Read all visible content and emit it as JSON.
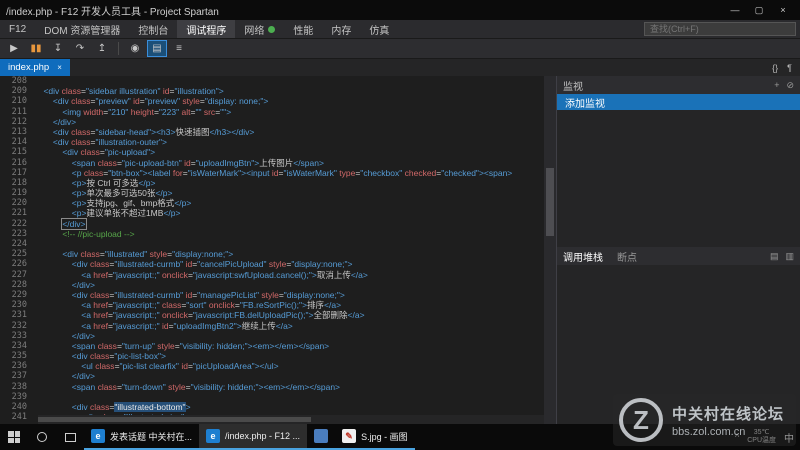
{
  "window": {
    "title": "/index.php - F12 开发人员工具 - Project Spartan",
    "controls": [
      {
        "id": "minimize",
        "glyph": "—"
      },
      {
        "id": "maximize",
        "glyph": "▢"
      },
      {
        "id": "close",
        "glyph": "×"
      }
    ]
  },
  "menubar": {
    "items": [
      {
        "id": "f12",
        "label": "F12"
      },
      {
        "id": "dom-explorer",
        "label": "DOM 资源管理器"
      },
      {
        "id": "console",
        "label": "控制台"
      },
      {
        "id": "debugger",
        "label": "调试程序",
        "active": true
      },
      {
        "id": "network",
        "label": "网络",
        "badge": true
      },
      {
        "id": "performance",
        "label": "性能"
      },
      {
        "id": "memory",
        "label": "内存"
      },
      {
        "id": "emulation",
        "label": "仿真"
      }
    ],
    "search_placeholder": "查找(Ctrl+F)"
  },
  "toolbar": {
    "icons": [
      {
        "id": "continue",
        "glyph": "▶"
      },
      {
        "id": "break",
        "glyph": "▮▮",
        "color": "#e8973d"
      },
      {
        "id": "step-into",
        "glyph": "↧"
      },
      {
        "id": "step-over",
        "glyph": "↷"
      },
      {
        "id": "step-out",
        "glyph": "↥"
      },
      {
        "id": "divider"
      },
      {
        "id": "break-on-exception",
        "glyph": "◉"
      },
      {
        "id": "just-my-code",
        "glyph": "▤",
        "highlight": true
      },
      {
        "id": "debug-options",
        "glyph": "≡"
      }
    ]
  },
  "tabstrip": {
    "tabs": [
      {
        "id": "index-php",
        "label": "index.php",
        "close": "×",
        "active": true
      }
    ],
    "right_icons": [
      {
        "id": "pretty-print",
        "glyph": "{}"
      },
      {
        "id": "word-wrap",
        "glyph": "¶"
      }
    ]
  },
  "editor": {
    "lines": [
      {
        "n": 208,
        "t": []
      },
      {
        "n": 209,
        "t": [
          [
            "g",
            "    "
          ],
          [
            "b",
            "<div "
          ],
          [
            "r",
            "class"
          ],
          [
            "g",
            "="
          ],
          [
            "b",
            "\"sidebar illustration\" "
          ],
          [
            "r",
            "id"
          ],
          [
            "g",
            "="
          ],
          [
            "b",
            "\"illustration\">"
          ]
        ]
      },
      {
        "n": 210,
        "t": [
          [
            "g",
            "        "
          ],
          [
            "b",
            "<div "
          ],
          [
            "r",
            "class"
          ],
          [
            "g",
            "="
          ],
          [
            "b",
            "\"preview\" "
          ],
          [
            "r",
            "id"
          ],
          [
            "g",
            "="
          ],
          [
            "b",
            "\"preview\" "
          ],
          [
            "r",
            "style"
          ],
          [
            "g",
            "="
          ],
          [
            "b",
            "\"display: none;\">"
          ]
        ]
      },
      {
        "n": 211,
        "t": [
          [
            "g",
            "            "
          ],
          [
            "b",
            "<img "
          ],
          [
            "r",
            "width"
          ],
          [
            "g",
            "="
          ],
          [
            "b",
            "\"210\" "
          ],
          [
            "r",
            "height"
          ],
          [
            "g",
            "="
          ],
          [
            "b",
            "\"223\" "
          ],
          [
            "r",
            "alt"
          ],
          [
            "g",
            "="
          ],
          [
            "b",
            "\"\" "
          ],
          [
            "r",
            "src"
          ],
          [
            "g",
            "="
          ],
          [
            "b",
            "\"\">"
          ]
        ]
      },
      {
        "n": 212,
        "t": [
          [
            "g",
            "        "
          ],
          [
            "b",
            "</div>"
          ]
        ]
      },
      {
        "n": 213,
        "t": [
          [
            "g",
            "        "
          ],
          [
            "b",
            "<div "
          ],
          [
            "r",
            "class"
          ],
          [
            "g",
            "="
          ],
          [
            "b",
            "\"sidebar-head\"><h3>"
          ],
          [
            "g",
            "快速插图"
          ],
          [
            "b",
            "</h3></div>"
          ]
        ]
      },
      {
        "n": 214,
        "t": [
          [
            "g",
            "        "
          ],
          [
            "b",
            "<div "
          ],
          [
            "r",
            "class"
          ],
          [
            "g",
            "="
          ],
          [
            "b",
            "\"illustration-outer\">"
          ]
        ]
      },
      {
        "n": 215,
        "t": [
          [
            "g",
            "            "
          ],
          [
            "b",
            "<div "
          ],
          [
            "r",
            "class"
          ],
          [
            "g",
            "="
          ],
          [
            "b",
            "\"pic-upload\">"
          ]
        ]
      },
      {
        "n": 216,
        "t": [
          [
            "g",
            "                "
          ],
          [
            "b",
            "<span "
          ],
          [
            "r",
            "class"
          ],
          [
            "g",
            "="
          ],
          [
            "b",
            "\"pic-upload-btn\" "
          ],
          [
            "r",
            "id"
          ],
          [
            "g",
            "="
          ],
          [
            "b",
            "\"uploadImgBtn\">"
          ],
          [
            "g",
            "上传图片"
          ],
          [
            "b",
            "</span>"
          ]
        ]
      },
      {
        "n": 217,
        "t": [
          [
            "g",
            "                "
          ],
          [
            "b",
            "<p "
          ],
          [
            "r",
            "class"
          ],
          [
            "g",
            "="
          ],
          [
            "b",
            "\"btn-box\"><label "
          ],
          [
            "r",
            "for"
          ],
          [
            "g",
            "="
          ],
          [
            "b",
            "\"isWaterMark\"><input "
          ],
          [
            "r",
            "id"
          ],
          [
            "g",
            "="
          ],
          [
            "b",
            "\"isWaterMark\" "
          ],
          [
            "r",
            "type"
          ],
          [
            "g",
            "="
          ],
          [
            "b",
            "\"checkbox\" "
          ],
          [
            "r",
            "checked"
          ],
          [
            "g",
            "="
          ],
          [
            "b",
            "\"checked\"><span>"
          ]
        ]
      },
      {
        "n": 218,
        "t": [
          [
            "g",
            "                "
          ],
          [
            "b",
            "<p>"
          ],
          [
            "g",
            "按 Ctrl 可多选"
          ],
          [
            "b",
            "</p>"
          ]
        ]
      },
      {
        "n": 219,
        "t": [
          [
            "g",
            "                "
          ],
          [
            "b",
            "<p>"
          ],
          [
            "g",
            "单次最多可选50张"
          ],
          [
            "b",
            "</p>"
          ]
        ]
      },
      {
        "n": 220,
        "t": [
          [
            "g",
            "                "
          ],
          [
            "b",
            "<p>"
          ],
          [
            "g",
            "支持jpg、gif、bmp格式"
          ],
          [
            "b",
            "</p>"
          ]
        ]
      },
      {
        "n": 221,
        "t": [
          [
            "g",
            "                "
          ],
          [
            "b",
            "<p>"
          ],
          [
            "g",
            "建议单张不超过1MB"
          ],
          [
            "b",
            "</p>"
          ]
        ]
      },
      {
        "n": 222,
        "t": [
          [
            "g",
            "            "
          ],
          [
            "x",
            "</div>"
          ]
        ]
      },
      {
        "n": 223,
        "t": [
          [
            "g",
            "            "
          ],
          [
            "c",
            "<!-- //pic-upload -->"
          ]
        ]
      },
      {
        "n": 224,
        "t": []
      },
      {
        "n": 225,
        "t": [
          [
            "g",
            "            "
          ],
          [
            "b",
            "<div "
          ],
          [
            "r",
            "class"
          ],
          [
            "g",
            "="
          ],
          [
            "b",
            "\"illustrated\" "
          ],
          [
            "r",
            "style"
          ],
          [
            "g",
            "="
          ],
          [
            "b",
            "\"display:none;\">"
          ]
        ]
      },
      {
        "n": 226,
        "t": [
          [
            "g",
            "                "
          ],
          [
            "b",
            "<div "
          ],
          [
            "r",
            "class"
          ],
          [
            "g",
            "="
          ],
          [
            "b",
            "\"illustrated-curmb\" "
          ],
          [
            "r",
            "id"
          ],
          [
            "g",
            "="
          ],
          [
            "b",
            "\"cancelPicUpload\" "
          ],
          [
            "r",
            "style"
          ],
          [
            "g",
            "="
          ],
          [
            "b",
            "\"display:none;\">"
          ]
        ]
      },
      {
        "n": 227,
        "t": [
          [
            "g",
            "                    "
          ],
          [
            "b",
            "<a "
          ],
          [
            "r",
            "href"
          ],
          [
            "g",
            "="
          ],
          [
            "b",
            "\"javascript:;\" "
          ],
          [
            "r",
            "onclick"
          ],
          [
            "g",
            "="
          ],
          [
            "b",
            "\"javascript:swfUpload.cancel();\">"
          ],
          [
            "g",
            "取消上传"
          ],
          [
            "b",
            "</a>"
          ]
        ]
      },
      {
        "n": 228,
        "t": [
          [
            "g",
            "                "
          ],
          [
            "b",
            "</div>"
          ]
        ]
      },
      {
        "n": 229,
        "t": [
          [
            "g",
            "                "
          ],
          [
            "b",
            "<div "
          ],
          [
            "r",
            "class"
          ],
          [
            "g",
            "="
          ],
          [
            "b",
            "\"illustrated-curmb\" "
          ],
          [
            "r",
            "id"
          ],
          [
            "g",
            "="
          ],
          [
            "b",
            "\"managePicList\" "
          ],
          [
            "r",
            "style"
          ],
          [
            "g",
            "="
          ],
          [
            "b",
            "\"display:none;\">"
          ]
        ]
      },
      {
        "n": 230,
        "t": [
          [
            "g",
            "                    "
          ],
          [
            "b",
            "<a "
          ],
          [
            "r",
            "href"
          ],
          [
            "g",
            "="
          ],
          [
            "b",
            "\"javascript:;\" "
          ],
          [
            "r",
            "class"
          ],
          [
            "g",
            "="
          ],
          [
            "b",
            "\"sort\" "
          ],
          [
            "r",
            "onclick"
          ],
          [
            "g",
            "="
          ],
          [
            "b",
            "\"FB.reSortPic();\">"
          ],
          [
            "g",
            "排序"
          ],
          [
            "b",
            "</a>"
          ]
        ]
      },
      {
        "n": 231,
        "t": [
          [
            "g",
            "                    "
          ],
          [
            "b",
            "<a "
          ],
          [
            "r",
            "href"
          ],
          [
            "g",
            "="
          ],
          [
            "b",
            "\"javascript:;\" "
          ],
          [
            "r",
            "onclick"
          ],
          [
            "g",
            "="
          ],
          [
            "b",
            "\"javascript:FB.delUploadPic();\">"
          ],
          [
            "g",
            "全部删除"
          ],
          [
            "b",
            "</a>"
          ]
        ]
      },
      {
        "n": 232,
        "t": [
          [
            "g",
            "                    "
          ],
          [
            "b",
            "<a "
          ],
          [
            "r",
            "href"
          ],
          [
            "g",
            "="
          ],
          [
            "b",
            "\"javascript:;\" "
          ],
          [
            "r",
            "id"
          ],
          [
            "g",
            "="
          ],
          [
            "b",
            "\"uploadImgBtn2\">"
          ],
          [
            "g",
            "继续上传"
          ],
          [
            "b",
            "</a>"
          ]
        ]
      },
      {
        "n": 233,
        "t": [
          [
            "g",
            "                "
          ],
          [
            "b",
            "</div>"
          ]
        ]
      },
      {
        "n": 234,
        "t": [
          [
            "g",
            "                "
          ],
          [
            "b",
            "<span "
          ],
          [
            "r",
            "class"
          ],
          [
            "g",
            "="
          ],
          [
            "b",
            "\"turn-up\" "
          ],
          [
            "r",
            "style"
          ],
          [
            "g",
            "="
          ],
          [
            "b",
            "\"visibility: hidden;\"><em></em></span>"
          ]
        ]
      },
      {
        "n": 235,
        "t": [
          [
            "g",
            "                "
          ],
          [
            "b",
            "<div "
          ],
          [
            "r",
            "class"
          ],
          [
            "g",
            "="
          ],
          [
            "b",
            "\"pic-list-box\">"
          ]
        ]
      },
      {
        "n": 236,
        "t": [
          [
            "g",
            "                    "
          ],
          [
            "b",
            "<ul "
          ],
          [
            "r",
            "class"
          ],
          [
            "g",
            "="
          ],
          [
            "b",
            "\"pic-list clearfix\" "
          ],
          [
            "r",
            "id"
          ],
          [
            "g",
            "="
          ],
          [
            "b",
            "\"picUploadArea\"></ul>"
          ]
        ]
      },
      {
        "n": 237,
        "t": [
          [
            "g",
            "                "
          ],
          [
            "b",
            "</div>"
          ]
        ]
      },
      {
        "n": 238,
        "t": [
          [
            "g",
            "                "
          ],
          [
            "b",
            "<span "
          ],
          [
            "r",
            "class"
          ],
          [
            "g",
            "="
          ],
          [
            "b",
            "\"turn-down\" "
          ],
          [
            "r",
            "style"
          ],
          [
            "g",
            "="
          ],
          [
            "b",
            "\"visibility: hidden;\"><em></em></span>"
          ]
        ]
      },
      {
        "n": 239,
        "t": []
      },
      {
        "n": 240,
        "t": [
          [
            "g",
            "                "
          ],
          [
            "b",
            "<div "
          ],
          [
            "r",
            "class"
          ],
          [
            "g",
            "="
          ],
          [
            "s",
            "\"illustrated-bottom\""
          ],
          [
            "b",
            ">"
          ]
        ]
      },
      {
        "n": 241,
        "t": [
          [
            "g",
            "                    "
          ],
          [
            "b",
            "<div "
          ],
          [
            "r",
            "class"
          ],
          [
            "g",
            "="
          ],
          [
            "b",
            "\"illustrated-size\">"
          ]
        ]
      }
    ]
  },
  "watch": {
    "title": "监视",
    "add_watch_label": "添加监视",
    "header_icons": [
      {
        "id": "add-watch",
        "glyph": "+"
      },
      {
        "id": "clear-watch",
        "glyph": "⊘"
      }
    ]
  },
  "callstack": {
    "tabs": [
      {
        "id": "callstack",
        "label": "调用堆栈",
        "active": true
      },
      {
        "id": "breakpoints",
        "label": "断点"
      }
    ],
    "header_icons": [
      {
        "id": "stack-frames",
        "glyph": "▤"
      },
      {
        "id": "stack-options",
        "glyph": "▥"
      }
    ]
  },
  "taskbar": {
    "tasks": [
      {
        "id": "browser-zol",
        "label": "发表话题 中关村在...",
        "icon_color": "#1e7fd0",
        "icon_glyph": "e"
      },
      {
        "id": "f12-window",
        "label": "/index.php - F12 ...",
        "icon_color": "#1e7fd0",
        "icon_glyph": "e",
        "active": true
      },
      {
        "id": "app",
        "label": "",
        "icon_color": "#4a7dbd",
        "icon_glyph": ""
      },
      {
        "id": "paint",
        "label": "S.jpg - 画图",
        "icon_color": "#f0f0f0",
        "icon_glyph": "✎",
        "icon_text_color": "#c0392b"
      }
    ],
    "tray": {
      "expand": "^",
      "temp": "35℃",
      "temp_label": "CPU温度",
      "ime": "中"
    }
  },
  "watermark": {
    "logo": "Z",
    "line1": "中关村在线论坛",
    "line2": "bbs.zol.com.cn"
  }
}
